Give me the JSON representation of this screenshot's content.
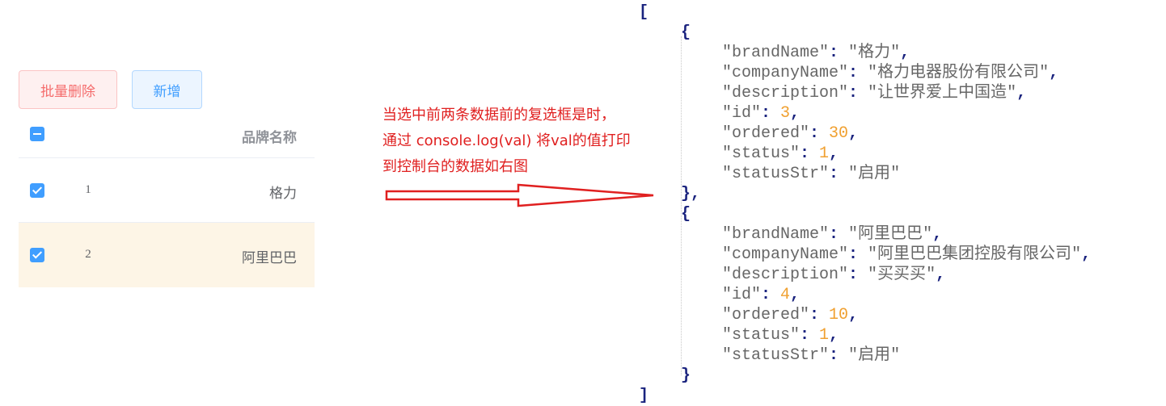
{
  "toolbar": {
    "batch_delete_label": "批量删除",
    "add_label": "新增"
  },
  "table": {
    "header": {
      "brand_column": "品牌名称"
    },
    "rows": [
      {
        "index": "1",
        "brand": "格力",
        "checked": true
      },
      {
        "index": "2",
        "brand": "阿里巴巴",
        "checked": true
      }
    ]
  },
  "annotation": {
    "lines": [
      "当选中前两条数据前的复选框是时，",
      "通过 console.log(val) 将val的值打印",
      "到控制台的数据如右图"
    ]
  },
  "console_output": {
    "open_bracket": "[",
    "close_bracket": "]",
    "items": [
      {
        "brandName": "格力",
        "companyName": "格力电器股份有限公司",
        "description": "让世界爱上中国造",
        "id": "3",
        "ordered": "30",
        "status": "1",
        "statusStr": "启用"
      },
      {
        "brandName": "阿里巴巴",
        "companyName": "阿里巴巴集团控股有限公司",
        "description": "买买买",
        "id": "4",
        "ordered": "10",
        "status": "1",
        "statusStr": "启用"
      }
    ]
  },
  "colors": {
    "danger": "#f56c6c",
    "primary": "#409eff",
    "annotation": "#e02020",
    "number": "#f0a030",
    "selected_row": "#fdf5e6"
  }
}
